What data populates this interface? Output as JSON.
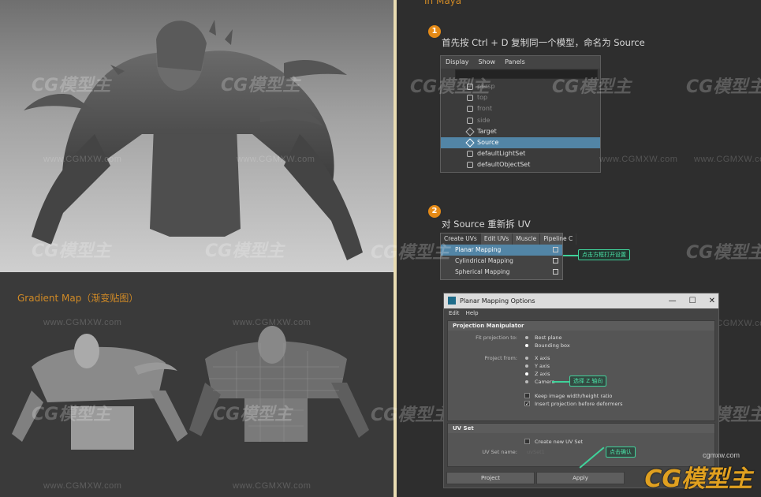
{
  "left": {
    "gradient_label": "Gradient Map（渐变贴图）"
  },
  "right": {
    "section_title": "In Maya",
    "step1": {
      "num": "1",
      "text": "首先按 Ctrl + D 复制同一个模型，命名为 Source"
    },
    "step2": {
      "num": "2",
      "text": "对 Source 重新拆 UV"
    },
    "outliner": {
      "menu": [
        "Display",
        "Show",
        "Panels"
      ],
      "items": [
        {
          "label": "persp",
          "dim": true,
          "selected": false
        },
        {
          "label": "top",
          "dim": true,
          "selected": false
        },
        {
          "label": "front",
          "dim": true,
          "selected": false
        },
        {
          "label": "side",
          "dim": true,
          "selected": false
        },
        {
          "label": "Target",
          "dim": false,
          "selected": false
        },
        {
          "label": "Source",
          "dim": false,
          "selected": true
        },
        {
          "label": "defaultLightSet",
          "dim": false,
          "selected": false
        },
        {
          "label": "defaultObjectSet",
          "dim": false,
          "selected": false
        }
      ]
    },
    "uv_menu": {
      "tabs": [
        "Create UVs",
        "Edit UVs",
        "Muscle",
        "Pipeline C"
      ],
      "items": [
        {
          "label": "Planar Mapping",
          "selected": true
        },
        {
          "label": "Cylindrical Mapping",
          "selected": false
        },
        {
          "label": "Spherical Mapping",
          "selected": false
        }
      ],
      "callout": "点击方框打开设置"
    },
    "options": {
      "title": "Planar Mapping Options",
      "menu": [
        "Edit",
        "Help"
      ],
      "sec1": "Projection Manipulator",
      "fit_label": "Fit projection to:",
      "fit_options": [
        "Best plane",
        "Bounding box"
      ],
      "project_label": "Project from:",
      "project_options": [
        "X axis",
        "Y axis",
        "Z axis",
        "Camera"
      ],
      "z_callout": "选择 Z 轴向",
      "keep_ratio": "Keep image width/height ratio",
      "insert_before": "Insert projection before deformers",
      "sec2": "UV Set",
      "create_new": "Create new UV Set",
      "uvset_label": "UV Set name:",
      "uvset_value": "uvSet1",
      "apply_callout": "点击确认",
      "project_btn": "Project",
      "apply_btn": "Apply"
    }
  },
  "watermark": {
    "url": "www.CGMXW.com",
    "logo": "CG模型主",
    "brand_url": "cgmxw.com"
  },
  "colors": {
    "accent_orange": "#e58a16",
    "callout_green": "#3fd29a",
    "selection_blue": "#5285a6"
  }
}
